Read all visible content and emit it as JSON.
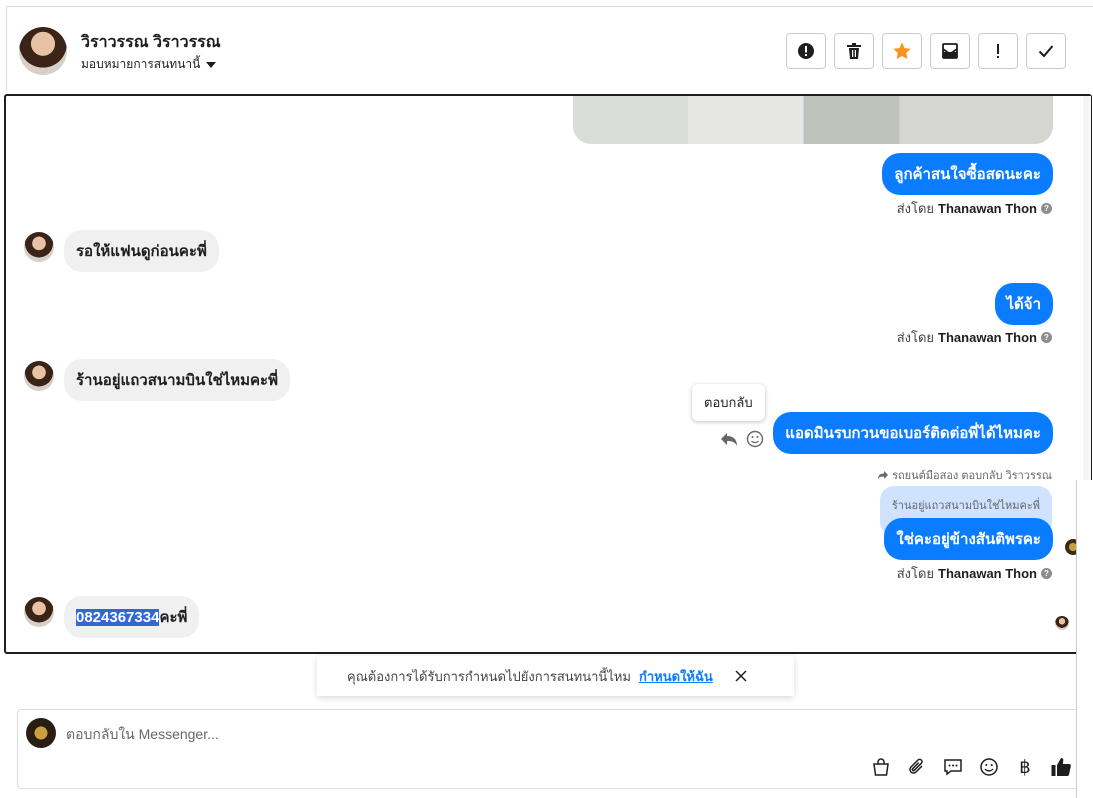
{
  "header": {
    "contact_name": "วิราวรรณ วิราวรรณ",
    "assign_label": "มอบหมายการสนทนานี้",
    "toolbar": [
      {
        "name": "mark-spam-button",
        "icon": "alert-circle-icon"
      },
      {
        "name": "delete-button",
        "icon": "trash-icon"
      },
      {
        "name": "star-button",
        "icon": "star-icon"
      },
      {
        "name": "mark-unread-button",
        "icon": "envelope-icon"
      },
      {
        "name": "follow-up-button",
        "icon": "exclamation-icon"
      },
      {
        "name": "mark-done-button",
        "icon": "check-icon"
      }
    ],
    "star_color": "#f7931e"
  },
  "messages": {
    "out1": "ลูกค้าสนใจซื้อสดนะคะ",
    "in1": "รอให้แฟนดูก่อนคะพี่",
    "out2": "ได้จ้า",
    "in2": "ร้านอยู่แถวสนามบินใช่ไหมคะพี่",
    "out3": "แอดมินรบกวนขอเบอร์ติดต่อพี่ได้ไหมคะ",
    "reply_meta": "รถยนต์มือสอง ตอบกลับ วิราวรรณ",
    "quoted": "ร้านอยู่แถวสนามบินใช่ไหมคะพี่",
    "out4": "ใช่คะอยู่ข้างสันติพรคะ",
    "in3_highlight": "0824367334",
    "in3_rest": "คะพี่",
    "sent_by_label": "ส่งโดย",
    "sent_by_name": "Thanawan Thon",
    "tooltip_reply": "ตอบกลับ"
  },
  "suggestion": {
    "text": "คุณต้องการได้รับการกำหนดไปยังการสนทนานี้ไหม",
    "link": "กำหนดให้ฉัน"
  },
  "composer": {
    "placeholder": "ตอบกลับใน Messenger...",
    "tools": [
      "shopping-bag-icon",
      "paperclip-icon",
      "saved-reply-icon",
      "emoji-icon",
      "baht-icon",
      "thumbs-up-icon"
    ]
  },
  "colors": {
    "accent": "#0a7cff",
    "incoming_bubble": "#f0f0f0",
    "quoted_bubble": "#cfe3ff",
    "selection": "#3367d6"
  }
}
